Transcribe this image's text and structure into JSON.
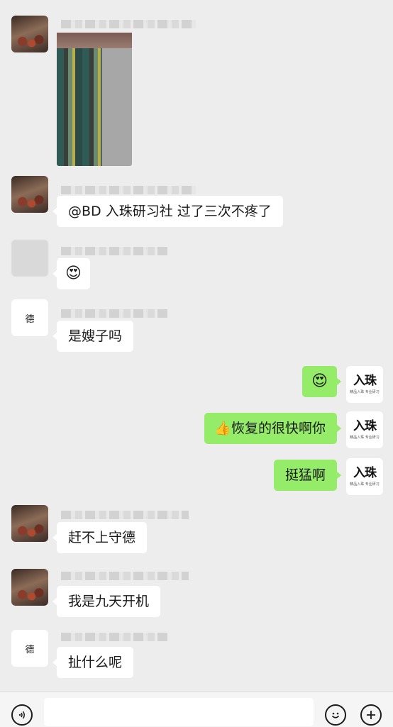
{
  "messages": {
    "m2_text": "@BD 入珠研习社  过了三次不疼了",
    "m3_emoji": "😍",
    "m4_text": "是嫂子吗",
    "m5_emoji": "😍",
    "m6_thumb": "👍",
    "m6_text": "恢复的很快啊你",
    "m7_text": "挺猛啊",
    "m8_text": "赶不上守德",
    "m9_text": "我是九天开机",
    "m10_text": "扯什么呢"
  },
  "brand_avatar": {
    "main": "入珠",
    "sub": "精品入珠 专业研习",
    "accent": "#c0282a"
  },
  "avatar_labels": {
    "de": "德"
  },
  "icons": {
    "voice": "voice-icon",
    "emoji": "emoji-icon",
    "plus": "plus-icon"
  },
  "colors": {
    "background": "#ededed",
    "self_bubble": "#95ec69",
    "other_bubble": "#ffffff"
  }
}
